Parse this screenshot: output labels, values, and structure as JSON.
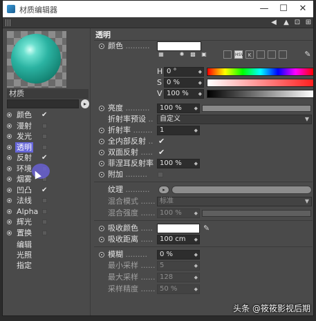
{
  "window": {
    "title": "材质编辑器",
    "controls": {
      "minimize": "—",
      "maximize": "☐",
      "close": "✕"
    }
  },
  "toolbar": {
    "back": "◀",
    "up": "▲",
    "lock": "⊡",
    "expand": "⊞"
  },
  "material": {
    "label": "材质",
    "sphere_color": "#2bb3a2"
  },
  "channels": [
    {
      "label": "颜色",
      "enabled": true,
      "checkmark": "✔"
    },
    {
      "label": "漫射",
      "enabled": false
    },
    {
      "label": "发光",
      "enabled": false
    },
    {
      "label": "透明",
      "enabled": false,
      "active": true
    },
    {
      "label": "反射",
      "enabled": true,
      "checkmark": "✔"
    },
    {
      "label": "环境",
      "enabled": false
    },
    {
      "label": "烟雾",
      "enabled": false
    },
    {
      "label": "凹凸",
      "enabled": true,
      "checkmark": "✔"
    },
    {
      "label": "法线",
      "enabled": false
    },
    {
      "label": "Alpha",
      "enabled": false
    },
    {
      "label": "辉光",
      "enabled": false
    },
    {
      "label": "置换",
      "enabled": false
    }
  ],
  "extra_items": [
    "编辑",
    "光照",
    "指定"
  ],
  "panel": {
    "section_title": "透明",
    "color": {
      "label": "颜色",
      "dots": "..........",
      "swatch": "#ffffff"
    },
    "hsv": {
      "h": {
        "label": "H",
        "value": "0 °"
      },
      "s": {
        "label": "S",
        "value": "0 %"
      },
      "v": {
        "label": "V",
        "value": "100 %"
      }
    },
    "icon_names": [
      "eyedropper-icon",
      "spectrum-icon",
      "image-icon",
      "rgb-icon",
      "hsv-icon",
      "kelvin-icon",
      "mixer-icon",
      "palette-icon",
      "custom-icon"
    ],
    "icon_labels": [
      "RGB",
      "HSV",
      "K",
      "",
      "",
      ""
    ],
    "eyedropper": "✎",
    "brightness": {
      "label": "亮度",
      "dots": "..........",
      "value": "100 %"
    },
    "ior_preset": {
      "label": "折射率预设",
      "dots": "..",
      "value": "自定义"
    },
    "ior": {
      "label": "折射率",
      "dots": "........",
      "value": "1"
    },
    "total_internal": {
      "label": "全内部反射",
      "dots": "..",
      "checked": "✔"
    },
    "double_sided": {
      "label": "双面反射",
      "dots": ".....",
      "checked": "✔"
    },
    "fresnel": {
      "label": "菲涅耳反射率",
      "value": "100 %"
    },
    "additive": {
      "label": "附加",
      "dots": "........."
    },
    "texture": {
      "label": "纹理",
      "dots": "..........",
      "btn": "▸"
    },
    "mix_mode": {
      "label": "混合模式",
      "dots": "......",
      "value": "标准"
    },
    "mix_strength": {
      "label": "混合强度",
      "dots": "......",
      "value": "100 %"
    },
    "absorb_color": {
      "label": "吸收颜色",
      "dots": ".....",
      "swatch": "#ffffff"
    },
    "absorb_distance": {
      "label": "吸收距离",
      "dots": ".....",
      "value": "100 cm"
    },
    "blur": {
      "label": "模糊",
      "dots": ".........",
      "value": "0 %"
    },
    "min_samples": {
      "label": "最小采样",
      "dots": "......",
      "value": "5"
    },
    "max_samples": {
      "label": "最大采样",
      "dots": "......",
      "value": "128"
    },
    "sample_accuracy": {
      "label": "采样精度",
      "dots": "......",
      "value": "50 %"
    }
  },
  "watermark": "头条 @筱筱影视后期"
}
